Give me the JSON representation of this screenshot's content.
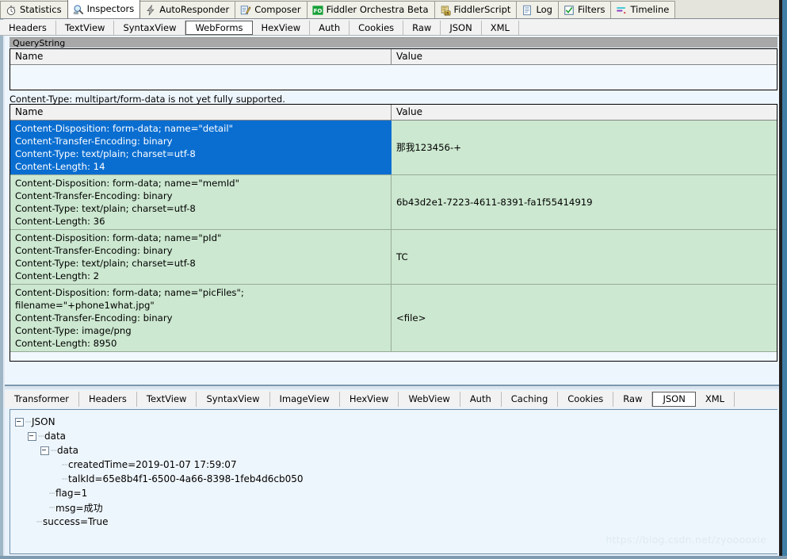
{
  "top_tabs": [
    {
      "label": "Statistics",
      "icon": "stopwatch-icon",
      "selected": false
    },
    {
      "label": "Inspectors",
      "icon": "magnifier-icon",
      "selected": true
    },
    {
      "label": "AutoResponder",
      "icon": "lightning-icon",
      "selected": false
    },
    {
      "label": "Composer",
      "icon": "compose-pencil-icon",
      "selected": false
    },
    {
      "label": "Fiddler Orchestra Beta",
      "icon": "fo-badge-icon",
      "selected": false
    },
    {
      "label": "FiddlerScript",
      "icon": "js-scroll-icon",
      "selected": false
    },
    {
      "label": "Log",
      "icon": "log-document-icon",
      "selected": false
    },
    {
      "label": "Filters",
      "icon": "checkbox-filter-icon",
      "selected": false
    },
    {
      "label": "Timeline",
      "icon": "timeline-icon",
      "selected": false
    }
  ],
  "request_tabs": [
    {
      "label": "Headers",
      "selected": false
    },
    {
      "label": "TextView",
      "selected": false
    },
    {
      "label": "SyntaxView",
      "selected": false
    },
    {
      "label": "WebForms",
      "selected": true
    },
    {
      "label": "HexView",
      "selected": false
    },
    {
      "label": "Auth",
      "selected": false
    },
    {
      "label": "Cookies",
      "selected": false
    },
    {
      "label": "Raw",
      "selected": false
    },
    {
      "label": "JSON",
      "selected": false
    },
    {
      "label": "XML",
      "selected": false
    }
  ],
  "querystring": {
    "group_header": "QueryString",
    "col_name": "Name",
    "col_value": "Value",
    "rows": []
  },
  "notice": "Content-Type: multipart/form-data is not yet fully supported.",
  "body_table": {
    "col_name": "Name",
    "col_value": "Value",
    "rows": [
      {
        "selected": true,
        "name_lines": [
          "Content-Disposition: form-data; name=\"detail\"",
          "Content-Transfer-Encoding: binary",
          "Content-Type: text/plain; charset=utf-8",
          "Content-Length: 14"
        ],
        "value": "那我123456-+"
      },
      {
        "selected": false,
        "name_lines": [
          "Content-Disposition: form-data; name=\"memId\"",
          "Content-Transfer-Encoding: binary",
          "Content-Type: text/plain; charset=utf-8",
          "Content-Length: 36"
        ],
        "value": "6b43d2e1-7223-4611-8391-fa1f55414919"
      },
      {
        "selected": false,
        "name_lines": [
          "Content-Disposition: form-data; name=\"pId\"",
          "Content-Transfer-Encoding: binary",
          "Content-Type: text/plain; charset=utf-8",
          "Content-Length: 2"
        ],
        "value": "TC"
      },
      {
        "selected": false,
        "name_lines": [
          "Content-Disposition: form-data; name=\"picFiles\";",
          "filename=\"+phone1what.jpg\"",
          "Content-Transfer-Encoding: binary",
          "Content-Type: image/png",
          "Content-Length: 8950"
        ],
        "value": "<file>"
      }
    ]
  },
  "response_tabs": [
    {
      "label": "Transformer",
      "selected": false
    },
    {
      "label": "Headers",
      "selected": false
    },
    {
      "label": "TextView",
      "selected": false
    },
    {
      "label": "SyntaxView",
      "selected": false
    },
    {
      "label": "ImageView",
      "selected": false
    },
    {
      "label": "HexView",
      "selected": false
    },
    {
      "label": "WebView",
      "selected": false
    },
    {
      "label": "Auth",
      "selected": false
    },
    {
      "label": "Caching",
      "selected": false
    },
    {
      "label": "Cookies",
      "selected": false
    },
    {
      "label": "Raw",
      "selected": false
    },
    {
      "label": "JSON",
      "selected": true
    },
    {
      "label": "XML",
      "selected": false
    }
  ],
  "json_tree": [
    {
      "depth": 0,
      "label": "JSON",
      "expander": true
    },
    {
      "depth": 1,
      "label": "data",
      "expander": true
    },
    {
      "depth": 2,
      "label": "data",
      "expander": true
    },
    {
      "depth": 3,
      "label": "createdTime=2019-01-07 17:59:07",
      "expander": false
    },
    {
      "depth": 3,
      "label": "talkId=65e8b4f1-6500-4a66-8398-1feb4d6cb050",
      "expander": false
    },
    {
      "depth": 2,
      "label": "flag=1",
      "expander": false
    },
    {
      "depth": 2,
      "label": "msg=成功",
      "expander": false
    },
    {
      "depth": 1,
      "label": "success=True",
      "expander": false
    }
  ],
  "watermark": "https://blog.csdn.net/zyooooxie",
  "colors": {
    "selection_blue": "#0a6ed1",
    "row_green": "#cce8d0",
    "pane_blue": "#eef6fd",
    "group_header_gray": "#a8a8a8"
  }
}
